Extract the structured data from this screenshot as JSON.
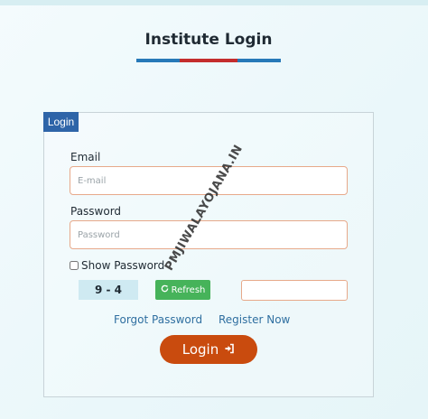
{
  "page": {
    "title": "Institute Login"
  },
  "form": {
    "legend": "Login",
    "email_label": "Email",
    "email_placeholder": "E-mail",
    "email_value": "",
    "password_label": "Password",
    "password_placeholder": "Password",
    "password_value": "",
    "show_password_label": "Show Password",
    "show_password_checked": false,
    "captcha_text": "9 - 4",
    "refresh_label": "Refresh",
    "captcha_value": "",
    "forgot_password_label": "Forgot Password",
    "register_label": "Register Now",
    "login_label": "Login"
  },
  "watermark": {
    "text": "PMJIWALAYOJANA.IN"
  },
  "icons": {
    "refresh": "refresh-icon",
    "login": "sign-in-icon"
  },
  "colors": {
    "title_underline_blue": "#2779b8",
    "title_underline_red": "#c42d2d",
    "legend_bg": "#2e64a8",
    "input_border": "#e7a98a",
    "captcha_bg": "#cfeaf2",
    "refresh_bg": "#46b35a",
    "link": "#2f6fa0",
    "login_button_bg": "#c94b0e"
  }
}
